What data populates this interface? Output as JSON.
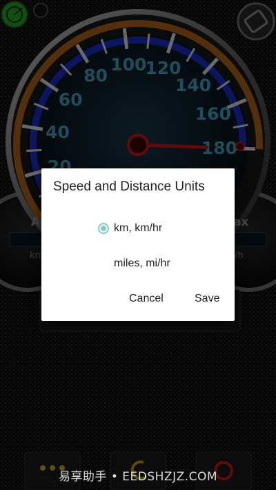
{
  "gauge": {
    "ticks": [
      "20",
      "40",
      "60",
      "80",
      "100",
      "120",
      "140",
      "160",
      "180"
    ],
    "needle_value": 180,
    "left_label_big": "A",
    "left_label_small": "km",
    "right_label_big": "ax",
    "right_label_small": "/h"
  },
  "dialog": {
    "title": "Speed and Distance Units",
    "options": [
      {
        "label": "km, km/hr",
        "selected": true
      },
      {
        "label": "miles, mi/hr",
        "selected": false
      }
    ],
    "cancel_label": "Cancel",
    "save_label": "Save"
  },
  "watermark": "易享助手 • EEDSHZJZ.COM",
  "colors": {
    "accent": "#80cbc4",
    "gauge_blue": "#1d2fd0",
    "tick_label": "#4aa9c9",
    "needle": "#d21a1a",
    "gps_green": "#2fa82f"
  },
  "icons": {
    "gps": "radar-icon",
    "rotate": "screen-rotation-icon",
    "menu": "more-dots-icon",
    "reset": "reset-icon",
    "power": "power-icon"
  }
}
